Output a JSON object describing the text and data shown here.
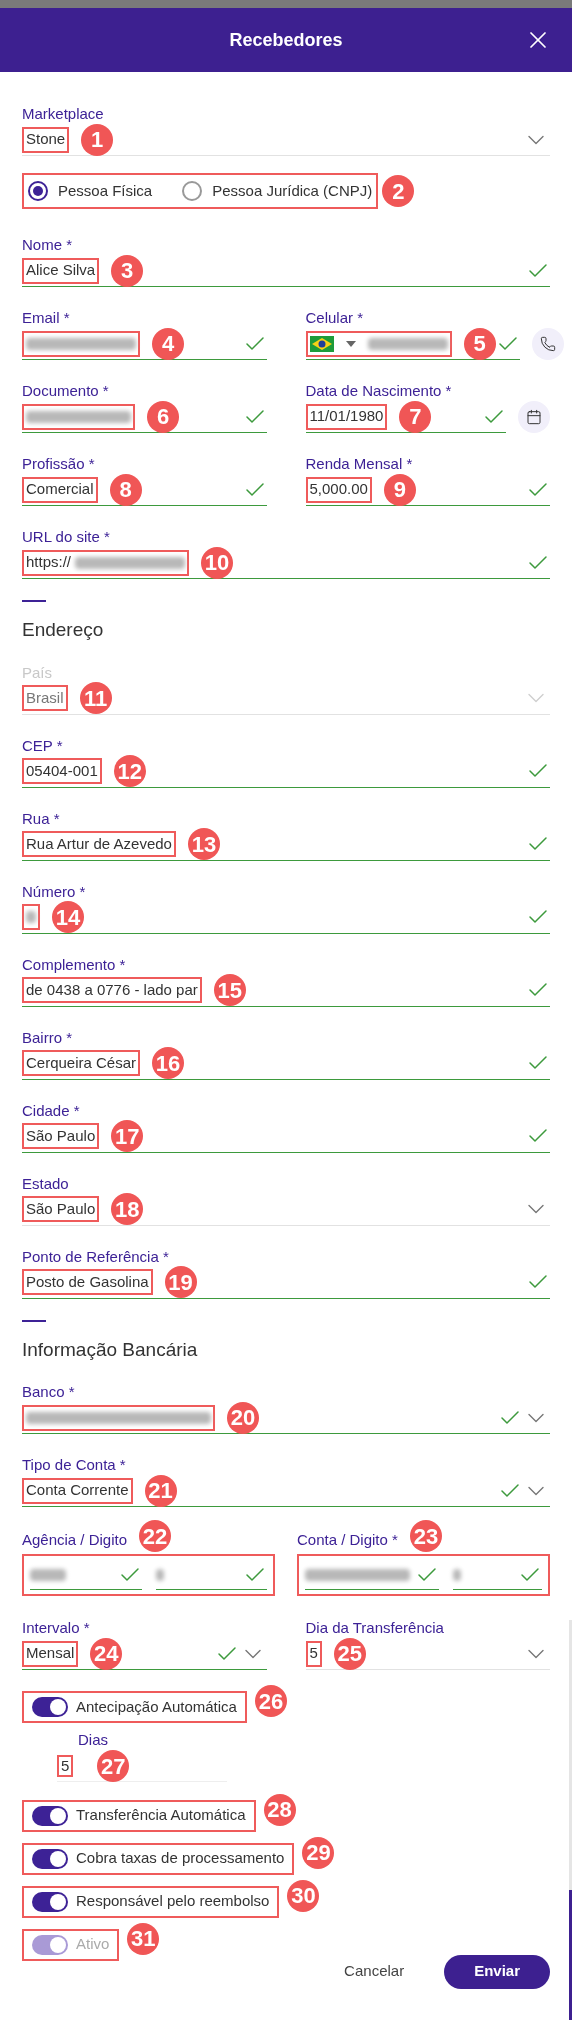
{
  "header": {
    "title": "Recebedores"
  },
  "marketplace": {
    "label": "Marketplace",
    "value": "Stone",
    "valid": false,
    "marker": "1"
  },
  "person_type": {
    "marker": "2",
    "options": [
      {
        "label": "Pessoa Física",
        "selected": true
      },
      {
        "label": "Pessoa Jurídica (CNPJ)",
        "selected": false
      }
    ]
  },
  "nome": {
    "label": "Nome *",
    "value": "Alice Silva",
    "valid": true,
    "marker": "3"
  },
  "email": {
    "label": "Email *",
    "redacted": true,
    "valid": true,
    "marker": "4"
  },
  "celular": {
    "label": "Celular *",
    "redacted": true,
    "valid": true,
    "marker": "5"
  },
  "documento": {
    "label": "Documento *",
    "redacted": true,
    "valid": true,
    "marker": "6"
  },
  "nascimento": {
    "label": "Data de Nascimento *",
    "value": "11/01/1980",
    "valid": true,
    "marker": "7"
  },
  "profissao": {
    "label": "Profissão *",
    "value": "Comercial",
    "valid": true,
    "marker": "8"
  },
  "renda": {
    "label": "Renda Mensal *",
    "value": "5,000.00",
    "valid": true,
    "marker": "9"
  },
  "url": {
    "label": "URL do site *",
    "value": "https://",
    "redacted": true,
    "valid": true,
    "marker": "10"
  },
  "address": {
    "title": "Endereço",
    "fields": [
      {
        "kind": "select",
        "label": "País",
        "value": "Brasil",
        "valid": false,
        "disabled": true,
        "marker": "11"
      },
      {
        "kind": "text",
        "label": "CEP *",
        "value": "05404-001",
        "valid": true,
        "disabled": false,
        "marker": "12"
      },
      {
        "kind": "text",
        "label": "Rua *",
        "value": "Rua Artur de Azevedo",
        "valid": true,
        "disabled": false,
        "marker": "13"
      },
      {
        "kind": "text",
        "label": "Número *",
        "redacted": true,
        "valid": true,
        "disabled": false,
        "marker": "14"
      },
      {
        "kind": "text",
        "label": "Complemento *",
        "value": "de 0438 a 0776 - lado par",
        "valid": true,
        "disabled": false,
        "marker": "15"
      },
      {
        "kind": "text",
        "label": "Bairro *",
        "value": "Cerqueira César",
        "valid": true,
        "disabled": false,
        "marker": "16"
      },
      {
        "kind": "text",
        "label": "Cidade *",
        "value": "São Paulo",
        "valid": true,
        "disabled": false,
        "marker": "17"
      },
      {
        "kind": "select",
        "label": "Estado",
        "value": "São Paulo",
        "valid": false,
        "disabled": false,
        "marker": "18"
      },
      {
        "kind": "text",
        "label": "Ponto de Referência *",
        "value": "Posto de Gasolina",
        "valid": true,
        "disabled": false,
        "marker": "19"
      }
    ]
  },
  "bank": {
    "title": "Informação Bancária",
    "banco": {
      "label": "Banco *",
      "redacted": true,
      "valid": true,
      "marker": "20"
    },
    "tipo": {
      "label": "Tipo de Conta *",
      "value": "Conta Corrente",
      "valid": true,
      "marker": "21"
    },
    "agencia": {
      "label": "Agência / Digito",
      "valid": true,
      "marker": "22"
    },
    "conta": {
      "label": "Conta / Digito *",
      "valid": true,
      "marker": "23"
    },
    "intervalo": {
      "label": "Intervalo *",
      "value": "Mensal",
      "valid": true,
      "marker": "24"
    },
    "dia": {
      "label": "Dia da Transferência",
      "value": "5",
      "valid": false,
      "marker": "25"
    }
  },
  "toggles": [
    {
      "label": "Antecipação Automática",
      "on": true,
      "disabled": false,
      "marker": "26",
      "days": {
        "label": "Dias",
        "value": "5",
        "marker": "27"
      }
    },
    {
      "label": "Transferência Automática",
      "on": true,
      "disabled": false,
      "marker": "28"
    },
    {
      "label": "Cobra taxas de processamento",
      "on": true,
      "disabled": false,
      "marker": "29"
    },
    {
      "label": "Responsável pelo reembolso",
      "on": true,
      "disabled": false,
      "marker": "30"
    },
    {
      "label": "Ativo",
      "on": true,
      "disabled": true,
      "marker": "31"
    }
  ],
  "buttons": {
    "cancel": "Cancelar",
    "submit": "Enviar"
  }
}
